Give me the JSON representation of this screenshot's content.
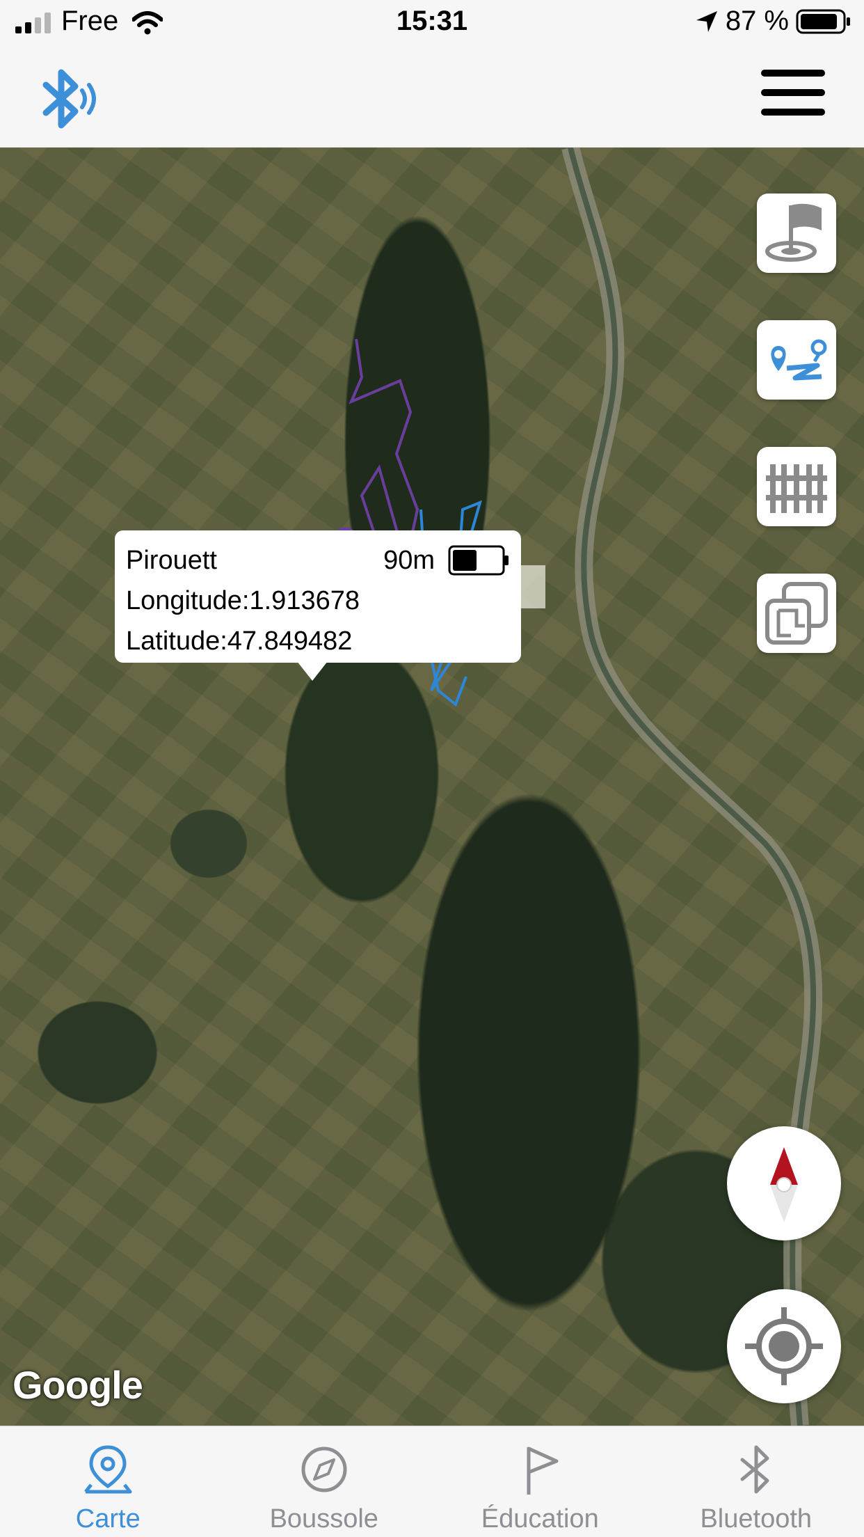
{
  "status_bar": {
    "carrier": "Free",
    "time": "15:31",
    "battery_percent": "87 %"
  },
  "header": {
    "bluetooth_icon": "bluetooth-signal-icon",
    "menu_icon": "hamburger-menu-icon"
  },
  "map": {
    "provider_logo": "Google",
    "popup": {
      "name": "Pirouett",
      "distance": "90m",
      "longitude": "Longitude:1.913678",
      "latitude": "Latitude:47.849482",
      "battery_level": 0.5
    },
    "side_buttons": [
      "flag-target-icon",
      "route-icon",
      "fence-icon",
      "map-layers-icon"
    ],
    "round_buttons": [
      "compass-icon",
      "recenter-icon"
    ],
    "colors": {
      "dog_1": "#6a3e9c",
      "dog_2": "#1a6fc4",
      "track_1": "#6a3e9c",
      "track_2": "#2e86d6"
    }
  },
  "tabs": [
    {
      "label": "Carte",
      "icon": "map-pin-icon",
      "active": true
    },
    {
      "label": "Boussole",
      "icon": "compass-icon",
      "active": false
    },
    {
      "label": "Éducation",
      "icon": "flag-icon",
      "active": false
    },
    {
      "label": "Bluetooth",
      "icon": "bluetooth-icon",
      "active": false
    }
  ],
  "colors": {
    "accent": "#3d8fd8",
    "inactive": "#8e8e93"
  }
}
